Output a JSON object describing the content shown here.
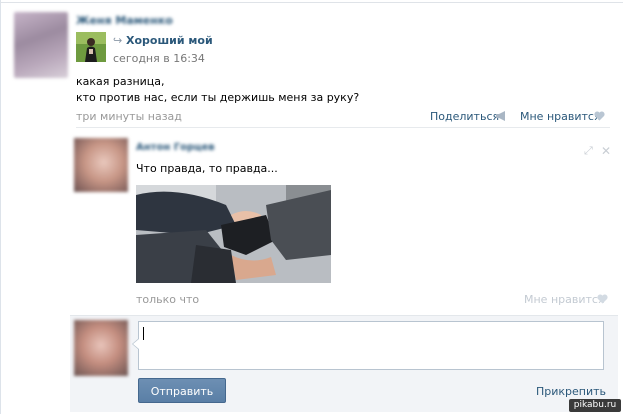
{
  "post": {
    "author_name": "Женя Маменко",
    "share": {
      "title": "Хороший мой",
      "date": "сегодня в 16:34"
    },
    "text_lines": [
      "какая разница,",
      "кто против нас, если ты держишь меня за руку?"
    ],
    "time": "три минуты назад",
    "share_label": "Поделиться",
    "like_label": "Мне нравится"
  },
  "comment": {
    "author_name": "Антон Горцев",
    "text": "Что правда, то правда...",
    "time": "только что",
    "like_label": "Мне нравится"
  },
  "reply": {
    "input_value": "",
    "send_label": "Отправить",
    "attach_label": "Прикрепить"
  },
  "watermark": "pikabu.ru",
  "colors": {
    "link": "#2b587a",
    "button": "#5a7fa6",
    "muted": "#999999",
    "reply_bg": "#f2f4f7"
  }
}
